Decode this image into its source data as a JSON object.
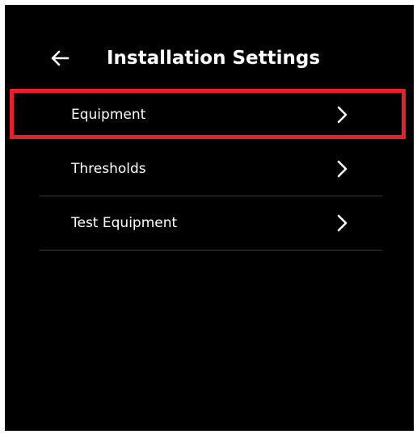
{
  "header": {
    "back_icon": "arrow-left-icon",
    "title": "Installation Settings"
  },
  "menu": {
    "items": [
      {
        "label": "Equipment",
        "icon": "chevron-right-icon"
      },
      {
        "label": "Thresholds",
        "icon": "chevron-right-icon"
      },
      {
        "label": "Test Equipment",
        "icon": "chevron-right-icon"
      }
    ]
  },
  "annotation": {
    "highlight_color": "#e5202a",
    "highlighted_item": "Equipment"
  },
  "colors": {
    "background": "#000000",
    "text": "#ffffff",
    "divider": "#3a3a3a"
  }
}
